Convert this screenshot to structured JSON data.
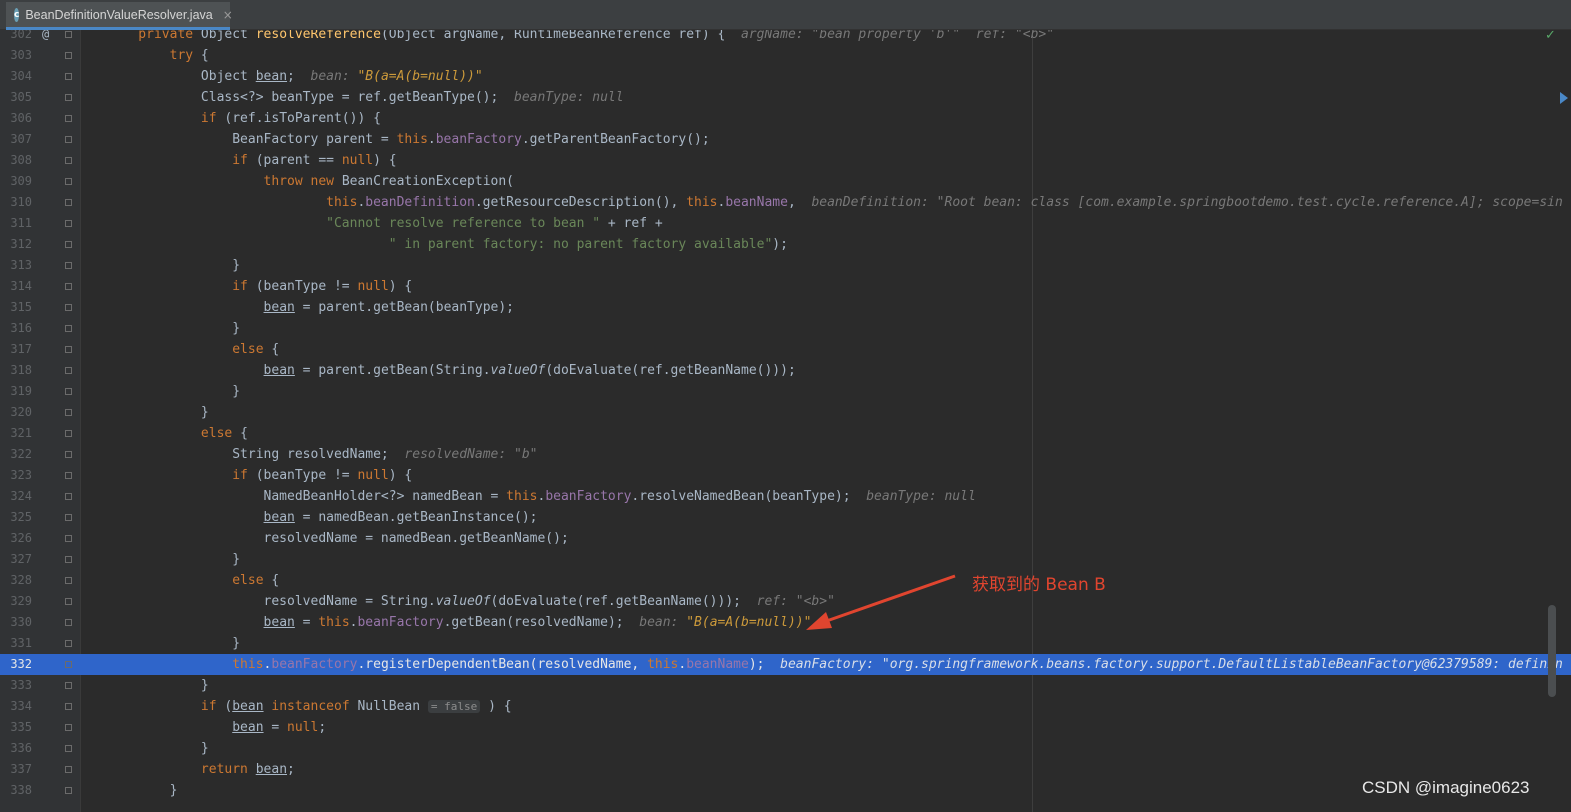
{
  "tab": {
    "filename": "BeanDefinitionValueResolver.java",
    "icon_letter": "c",
    "close_glyph": "×"
  },
  "gutter_marker": "@",
  "lines": [
    {
      "n": "302",
      "has_marker": true,
      "tokens": [
        [
          "kw",
          "    private "
        ],
        [
          "",
          "Object "
        ],
        [
          "fn",
          "resolveReference"
        ],
        [
          "",
          "(Object argName, RuntimeBeanReference ref) {  "
        ],
        [
          "hint",
          "argName: \"bean property 'b'\"  ref: \"<b>\""
        ]
      ]
    },
    {
      "n": "303",
      "tokens": [
        [
          "kw",
          "        try "
        ],
        [
          "",
          "{"
        ]
      ]
    },
    {
      "n": "304",
      "tokens": [
        [
          "",
          "            Object "
        ],
        [
          "ul",
          "bean"
        ],
        [
          "",
          ";  "
        ],
        [
          "hint",
          "bean: "
        ],
        [
          "sval",
          "\"B(a=A(b=null))\""
        ]
      ]
    },
    {
      "n": "305",
      "tokens": [
        [
          "",
          "            Class<?> beanType = ref.getBeanType();  "
        ],
        [
          "hint",
          "beanType: null"
        ]
      ]
    },
    {
      "n": "306",
      "tokens": [
        [
          "kw",
          "            if "
        ],
        [
          "",
          "(ref.isToParent()) {"
        ]
      ]
    },
    {
      "n": "307",
      "tokens": [
        [
          "",
          "                BeanFactory parent = "
        ],
        [
          "kw",
          "this"
        ],
        [
          "",
          "."
        ],
        [
          "fld",
          "beanFactory"
        ],
        [
          "",
          ".getParentBeanFactory();"
        ]
      ]
    },
    {
      "n": "308",
      "tokens": [
        [
          "kw",
          "                if "
        ],
        [
          "",
          "(parent == "
        ],
        [
          "kw",
          "null"
        ],
        [
          "",
          ") {"
        ]
      ]
    },
    {
      "n": "309",
      "tokens": [
        [
          "kw",
          "                    throw new "
        ],
        [
          "",
          "BeanCreationException("
        ]
      ]
    },
    {
      "n": "310",
      "tokens": [
        [
          "kw",
          "                            this"
        ],
        [
          "",
          "."
        ],
        [
          "fld",
          "beanDefinition"
        ],
        [
          "",
          ".getResourceDescription(), "
        ],
        [
          "kw",
          "this"
        ],
        [
          "",
          "."
        ],
        [
          "fld",
          "beanName"
        ],
        [
          "",
          ",  "
        ],
        [
          "hint",
          "beanDefinition: \"Root bean: class [com.example.springbootdemo.test.cycle.reference.A]; scope=sin"
        ]
      ]
    },
    {
      "n": "311",
      "tokens": [
        [
          "str",
          "                            \"Cannot resolve reference to bean \" "
        ],
        [
          "",
          "+ ref +"
        ]
      ]
    },
    {
      "n": "312",
      "tokens": [
        [
          "str",
          "                                    \" in parent factory: no parent factory available\""
        ],
        [
          "",
          ");"
        ]
      ]
    },
    {
      "n": "313",
      "tokens": [
        [
          "",
          "                }"
        ]
      ]
    },
    {
      "n": "314",
      "tokens": [
        [
          "kw",
          "                if "
        ],
        [
          "",
          "(beanType != "
        ],
        [
          "kw",
          "null"
        ],
        [
          "",
          ") {"
        ]
      ]
    },
    {
      "n": "315",
      "tokens": [
        [
          "",
          "                    "
        ],
        [
          "ul",
          "bean"
        ],
        [
          "",
          " = parent.getBean(beanType);"
        ]
      ]
    },
    {
      "n": "316",
      "tokens": [
        [
          "",
          "                }"
        ]
      ]
    },
    {
      "n": "317",
      "tokens": [
        [
          "kw",
          "                else "
        ],
        [
          "",
          "{"
        ]
      ]
    },
    {
      "n": "318",
      "tokens": [
        [
          "",
          "                    "
        ],
        [
          "ul",
          "bean"
        ],
        [
          "",
          " = parent.getBean(String."
        ],
        [
          "it",
          "valueOf"
        ],
        [
          "",
          "(doEvaluate(ref.getBeanName()));"
        ]
      ]
    },
    {
      "n": "319",
      "tokens": [
        [
          "",
          "                }"
        ]
      ]
    },
    {
      "n": "320",
      "tokens": [
        [
          "",
          "            }"
        ]
      ]
    },
    {
      "n": "321",
      "tokens": [
        [
          "kw",
          "            else "
        ],
        [
          "",
          "{"
        ]
      ]
    },
    {
      "n": "322",
      "tokens": [
        [
          "",
          "                String resolvedName;  "
        ],
        [
          "hint",
          "resolvedName: \"b\""
        ]
      ]
    },
    {
      "n": "323",
      "tokens": [
        [
          "kw",
          "                if "
        ],
        [
          "",
          "(beanType != "
        ],
        [
          "kw",
          "null"
        ],
        [
          "",
          ") {"
        ]
      ]
    },
    {
      "n": "324",
      "tokens": [
        [
          "",
          "                    NamedBeanHolder<?> namedBean = "
        ],
        [
          "kw",
          "this"
        ],
        [
          "",
          "."
        ],
        [
          "fld",
          "beanFactory"
        ],
        [
          "",
          ".resolveNamedBean(beanType);  "
        ],
        [
          "hint",
          "beanType: null"
        ]
      ]
    },
    {
      "n": "325",
      "tokens": [
        [
          "",
          "                    "
        ],
        [
          "ul",
          "bean"
        ],
        [
          "",
          " = namedBean.getBeanInstance();"
        ]
      ]
    },
    {
      "n": "326",
      "tokens": [
        [
          "",
          "                    resolvedName = namedBean.getBeanName();"
        ]
      ]
    },
    {
      "n": "327",
      "tokens": [
        [
          "",
          "                }"
        ]
      ]
    },
    {
      "n": "328",
      "tokens": [
        [
          "kw",
          "                else "
        ],
        [
          "",
          "{"
        ]
      ]
    },
    {
      "n": "329",
      "tokens": [
        [
          "",
          "                    resolvedName = String."
        ],
        [
          "it",
          "valueOf"
        ],
        [
          "",
          "(doEvaluate(ref.getBeanName()));  "
        ],
        [
          "hint",
          "ref: \"<b>\""
        ]
      ]
    },
    {
      "n": "330",
      "tokens": [
        [
          "",
          "                    "
        ],
        [
          "ul",
          "bean"
        ],
        [
          "",
          " = "
        ],
        [
          "kw",
          "this"
        ],
        [
          "",
          "."
        ],
        [
          "fld",
          "beanFactory"
        ],
        [
          "",
          ".getBean(resolvedName);  "
        ],
        [
          "hint",
          "bean: "
        ],
        [
          "sval",
          "\"B(a=A(b=null))\""
        ]
      ]
    },
    {
      "n": "331",
      "tokens": [
        [
          "",
          "                }"
        ]
      ]
    },
    {
      "n": "332",
      "exec": true,
      "tokens": [
        [
          "kw",
          "                this"
        ],
        [
          "",
          "."
        ],
        [
          "fld",
          "beanFactory"
        ],
        [
          "",
          ".registerDependentBean(resolvedName, "
        ],
        [
          "kw",
          "this"
        ],
        [
          "",
          "."
        ],
        [
          "fld",
          "beanName"
        ],
        [
          "",
          ");  "
        ],
        [
          "hint",
          "beanFactory: \"org.springframework.beans.factory.support.DefaultListableBeanFactory@62379589: definin"
        ]
      ]
    },
    {
      "n": "333",
      "tokens": [
        [
          "",
          "            }"
        ]
      ]
    },
    {
      "n": "334",
      "tokens": [
        [
          "kw",
          "            if "
        ],
        [
          "",
          "("
        ],
        [
          "ul",
          "bean"
        ],
        [
          "",
          " "
        ],
        [
          "kw",
          "instanceof "
        ],
        [
          "",
          "NullBean "
        ],
        [
          "inlay",
          "= false"
        ],
        [
          "",
          " ) {"
        ]
      ]
    },
    {
      "n": "335",
      "tokens": [
        [
          "",
          "                "
        ],
        [
          "ul",
          "bean"
        ],
        [
          "",
          " = "
        ],
        [
          "kw",
          "null"
        ],
        [
          "",
          ";"
        ]
      ]
    },
    {
      "n": "336",
      "tokens": [
        [
          "",
          "            }"
        ]
      ]
    },
    {
      "n": "337",
      "tokens": [
        [
          "kw",
          "            return "
        ],
        [
          "ul",
          "bean"
        ],
        [
          "",
          ";"
        ]
      ]
    },
    {
      "n": "338",
      "tokens": [
        [
          "",
          "        }"
        ]
      ]
    }
  ],
  "annotation": "获取到的 Bean B",
  "watermark": "CSDN @imagine0623",
  "check_glyph": "✓",
  "colors": {
    "accent": "#2f65ca",
    "keyword": "#cc7832",
    "method": "#ffc66d",
    "string": "#6a8759",
    "field": "#9876aa",
    "annotation": "#e0452f"
  }
}
